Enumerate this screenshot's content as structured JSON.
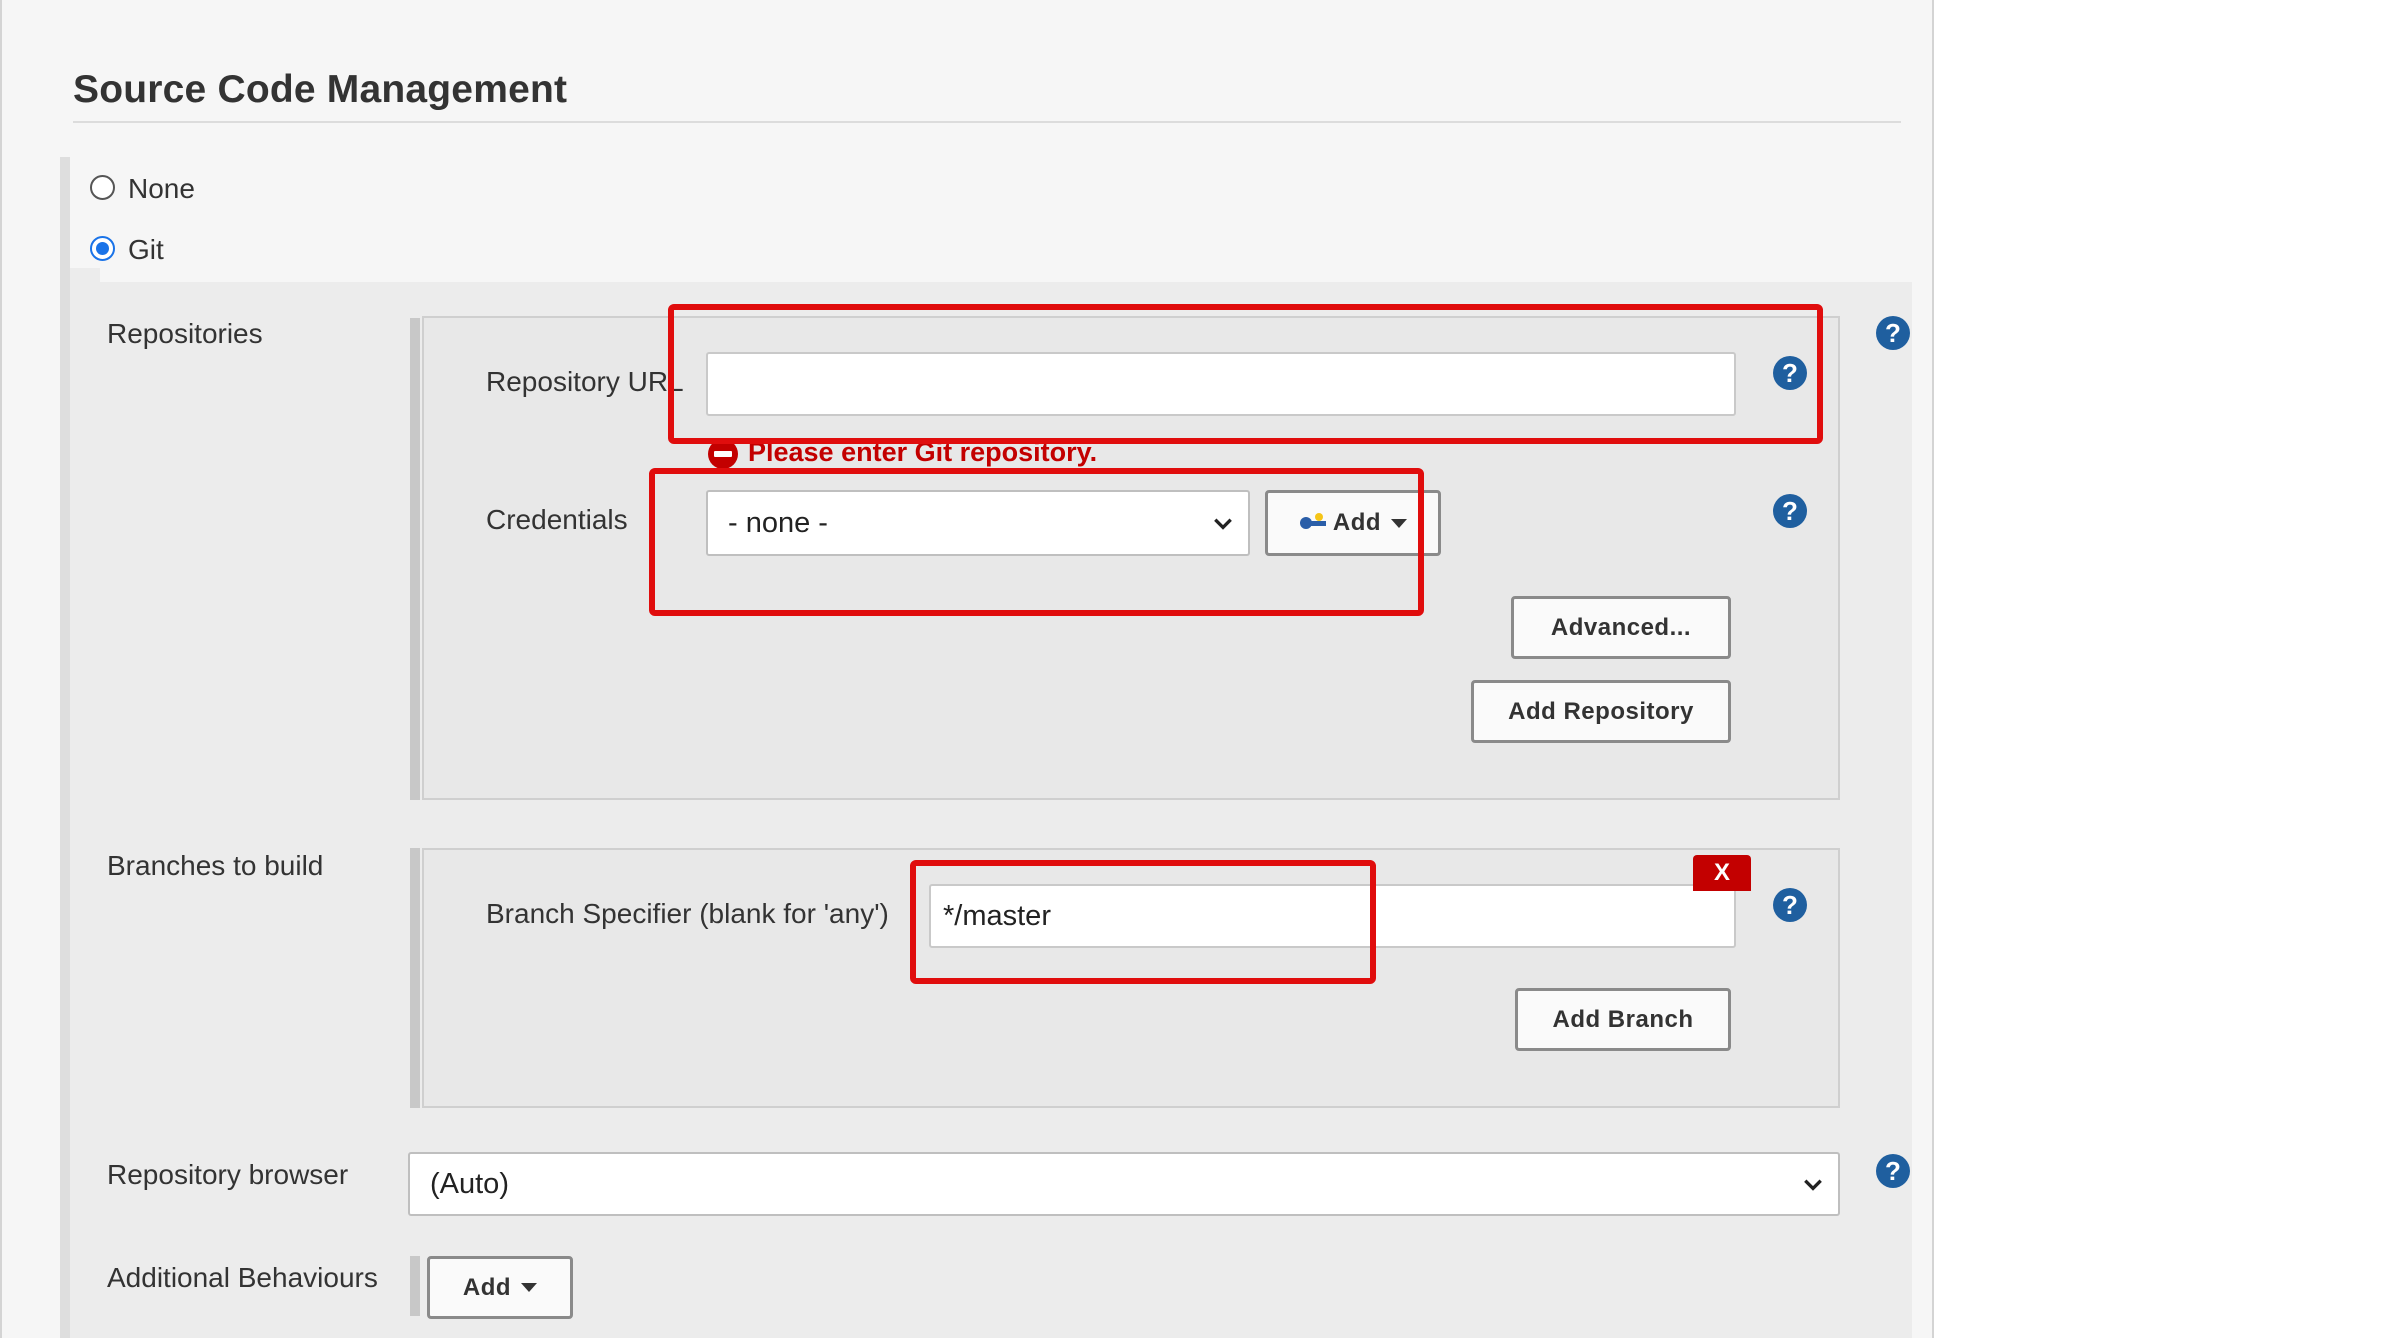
{
  "section": {
    "title": "Source Code Management"
  },
  "scm_options": [
    {
      "label": "None",
      "selected": false
    },
    {
      "label": "Git",
      "selected": true
    }
  ],
  "repositories": {
    "label": "Repositories",
    "repo_url_label": "Repository URL",
    "repo_url_value": "",
    "error_message": "Please enter Git repository.",
    "credentials_label": "Credentials",
    "credentials_selected": "- none -",
    "add_label": "Add",
    "advanced_label": "Advanced...",
    "add_repository_label": "Add Repository"
  },
  "branches": {
    "label": "Branches to build",
    "specifier_label": "Branch Specifier (blank for 'any')",
    "specifier_value": "*/master",
    "delete_label": "X",
    "add_branch_label": "Add Branch"
  },
  "repository_browser": {
    "label": "Repository browser",
    "selected": "(Auto)"
  },
  "additional_behaviours": {
    "label": "Additional Behaviours",
    "add_label": "Add"
  },
  "help_glyph": "?",
  "colors": {
    "highlight": "#e00d0d",
    "error": "#c30000",
    "help": "#1f5f9f",
    "radio_selected": "#1a73e8"
  }
}
